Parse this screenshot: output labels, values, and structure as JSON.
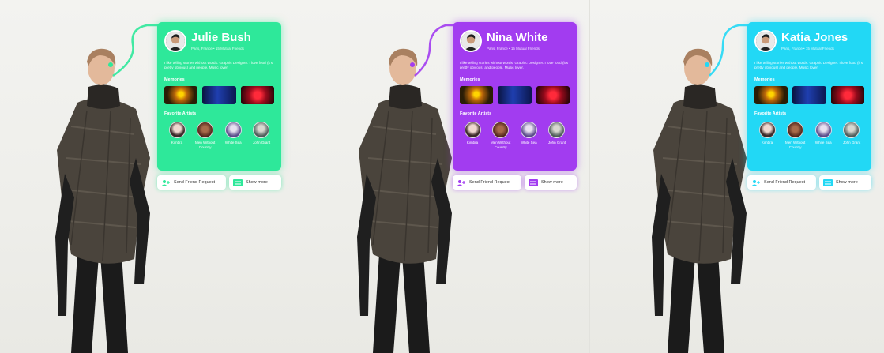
{
  "panels": [
    {
      "accent": "#2ee89a",
      "profile": {
        "name": "Julie Bush",
        "location": "Paris, France • 15 Mutual Friends",
        "bio": "I like telling stories without words. Graphic Designer. I love food (it’s pretty obvious) and people. Music lover."
      },
      "memories_title": "Memories",
      "artists_title": "Favorite Artists",
      "artists": [
        "Kimbra",
        "Men Without Country",
        "White Sea",
        "John Grant"
      ],
      "actions": {
        "friend_label": "Send Friend Request",
        "more_label": "Show more"
      }
    },
    {
      "accent": "#a23cf0",
      "profile": {
        "name": "Nina White",
        "location": "Paris, France • 15 Mutual Friends",
        "bio": "I like telling stories without words. Graphic Designer. I love food (it’s pretty obvious) and people. Music lover."
      },
      "memories_title": "Memories",
      "artists_title": "Favorite Artists",
      "artists": [
        "Kimbra",
        "Men Without Country",
        "White Sea",
        "John Grant"
      ],
      "actions": {
        "friend_label": "Send Friend Request",
        "more_label": "Show more"
      }
    },
    {
      "accent": "#22d8f5",
      "profile": {
        "name": "Katia Jones",
        "location": "Paris, France • 15 Mutual Friends",
        "bio": "I like telling stories without words. Graphic Designer. I love food (it’s pretty obvious) and people. Music lover."
      },
      "memories_title": "Memories",
      "artists_title": "Favorite Artists",
      "artists": [
        "Kimbra",
        "Men Without Country",
        "White Sea",
        "John Grant"
      ],
      "actions": {
        "friend_label": "Send Friend Request",
        "more_label": "Show more"
      }
    }
  ],
  "icons": {
    "friend": "add-user-icon",
    "more": "grid-list-icon"
  }
}
